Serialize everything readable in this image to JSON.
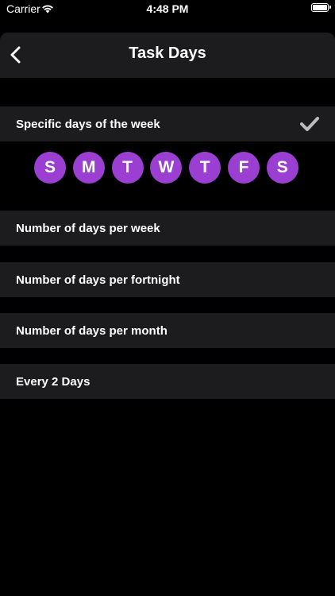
{
  "status_bar": {
    "carrier": "Carrier",
    "time": "4:48 PM",
    "wifi_icon": "wifi-icon",
    "battery_icon": "battery-icon"
  },
  "nav": {
    "title": "Task Days",
    "back_icon": "chevron-left-icon"
  },
  "options": [
    {
      "label": "Specific days of the week",
      "selected": true
    },
    {
      "label": "Number of days per week",
      "selected": false
    },
    {
      "label": "Number of days per fortnight",
      "selected": false
    },
    {
      "label": "Number of days per month",
      "selected": false
    },
    {
      "label": "Every 2 Days",
      "selected": false
    }
  ],
  "days": [
    "S",
    "M",
    "T",
    "W",
    "T",
    "F",
    "S"
  ],
  "colors": {
    "accent": "#9b3fd2",
    "row_background": "#1c1c1e",
    "background": "#000000",
    "checkmark": "#bdbdbd"
  }
}
